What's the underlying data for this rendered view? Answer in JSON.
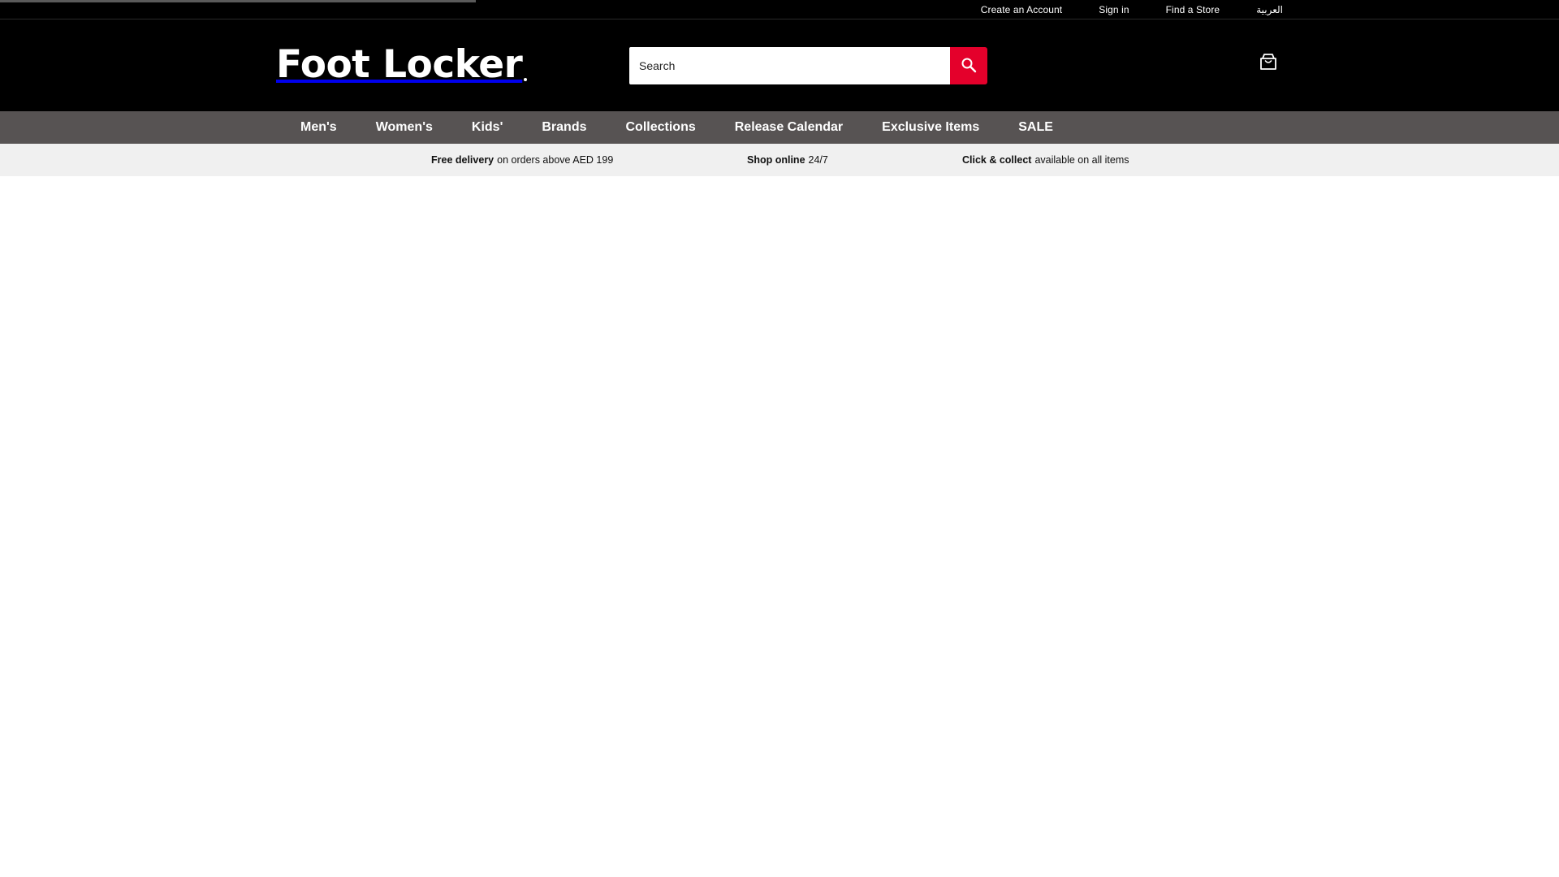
{
  "loading": {
    "progress": 0.305
  },
  "utility_nav": {
    "create_account": "Create an Account",
    "sign_in": "Sign in",
    "find_store": "Find a Store",
    "language": "العربية"
  },
  "header": {
    "logo_text": "Foot Locker",
    "search": {
      "placeholder": "Search",
      "value": ""
    },
    "icons": {
      "search": "search-icon",
      "cart": "shopping-bag-icon"
    },
    "colors": {
      "search_button": "#e4002b",
      "header_bg": "#000000",
      "nav_bg": "#575353"
    }
  },
  "main_nav": {
    "items": [
      {
        "label": "Men's"
      },
      {
        "label": "Women's"
      },
      {
        "label": "Kids'"
      },
      {
        "label": "Brands"
      },
      {
        "label": "Collections"
      },
      {
        "label": "Release Calendar"
      },
      {
        "label": "Exclusive Items"
      },
      {
        "label": "SALE"
      }
    ]
  },
  "promo_bar": {
    "items": [
      {
        "bold": "Free delivery",
        "text": "on orders above AED 199"
      },
      {
        "bold": "Shop online",
        "text": "24/7"
      },
      {
        "bold": "Click & collect",
        "text": "available on all items"
      }
    ]
  }
}
